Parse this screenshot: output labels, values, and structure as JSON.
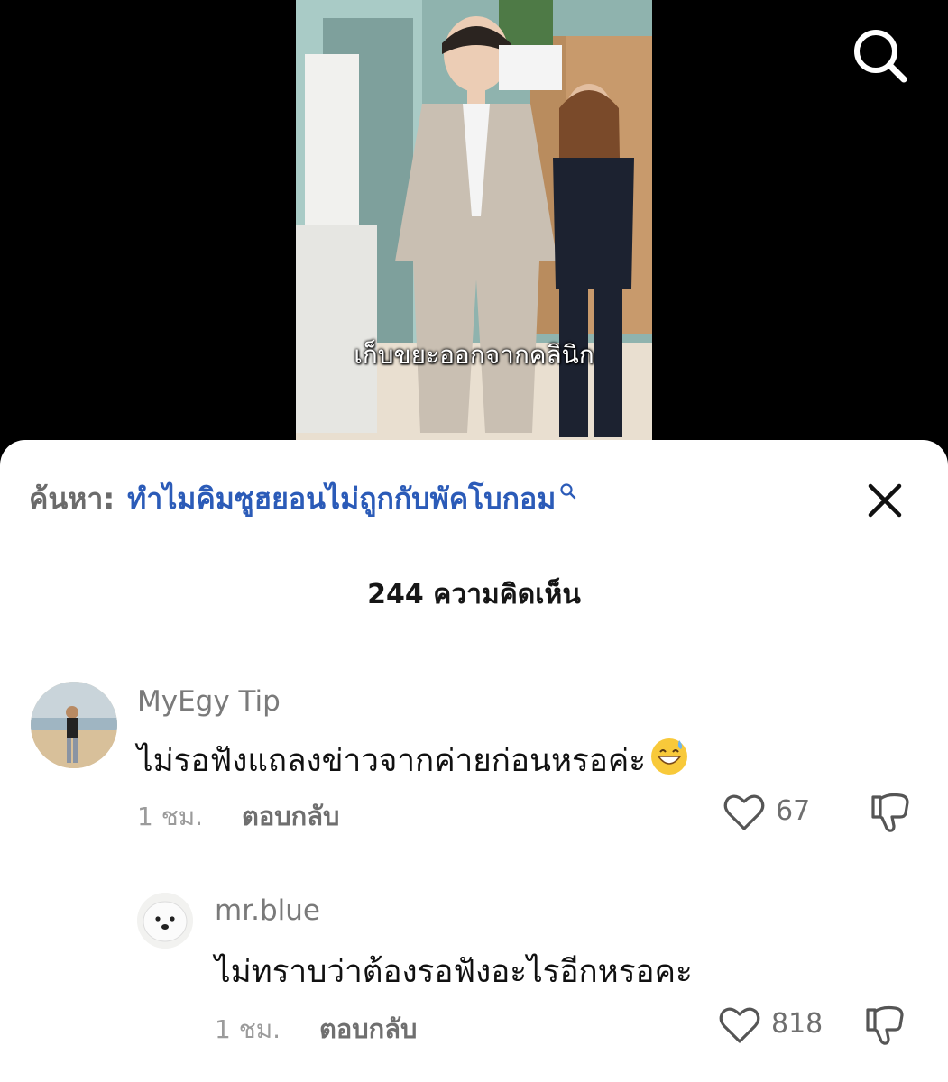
{
  "video": {
    "caption": "เก็บขยะออกจากคลินิก"
  },
  "header_icons": {
    "search": "search-icon"
  },
  "sheet": {
    "search_prefix": "ค้นหา:",
    "search_query": "ทำไมคิมซูฮยอนไม่ถูกกับพัคโบกอม",
    "comment_count_title": "244 ความคิดเห็น",
    "close_icon": "close-icon"
  },
  "comments": [
    {
      "username": "MyEgy Tip",
      "text": "ไม่รอฟังแถลงข่าวจากค่ายก่อนหรอค่ะ",
      "emoji": "grinning-sweat-emoji",
      "time": "1 ชม.",
      "reply_label": "ตอบกลับ",
      "likes": "67"
    },
    {
      "username": "mr.blue",
      "text": "ไม่ทราบว่าต้องรอฟังอะไรอีกหรอคะ",
      "time": "1 ชม.",
      "reply_label": "ตอบกลับ",
      "likes": "818"
    }
  ],
  "colors": {
    "link_blue": "#2b5bb8",
    "muted_gray": "#7a7a7a"
  }
}
